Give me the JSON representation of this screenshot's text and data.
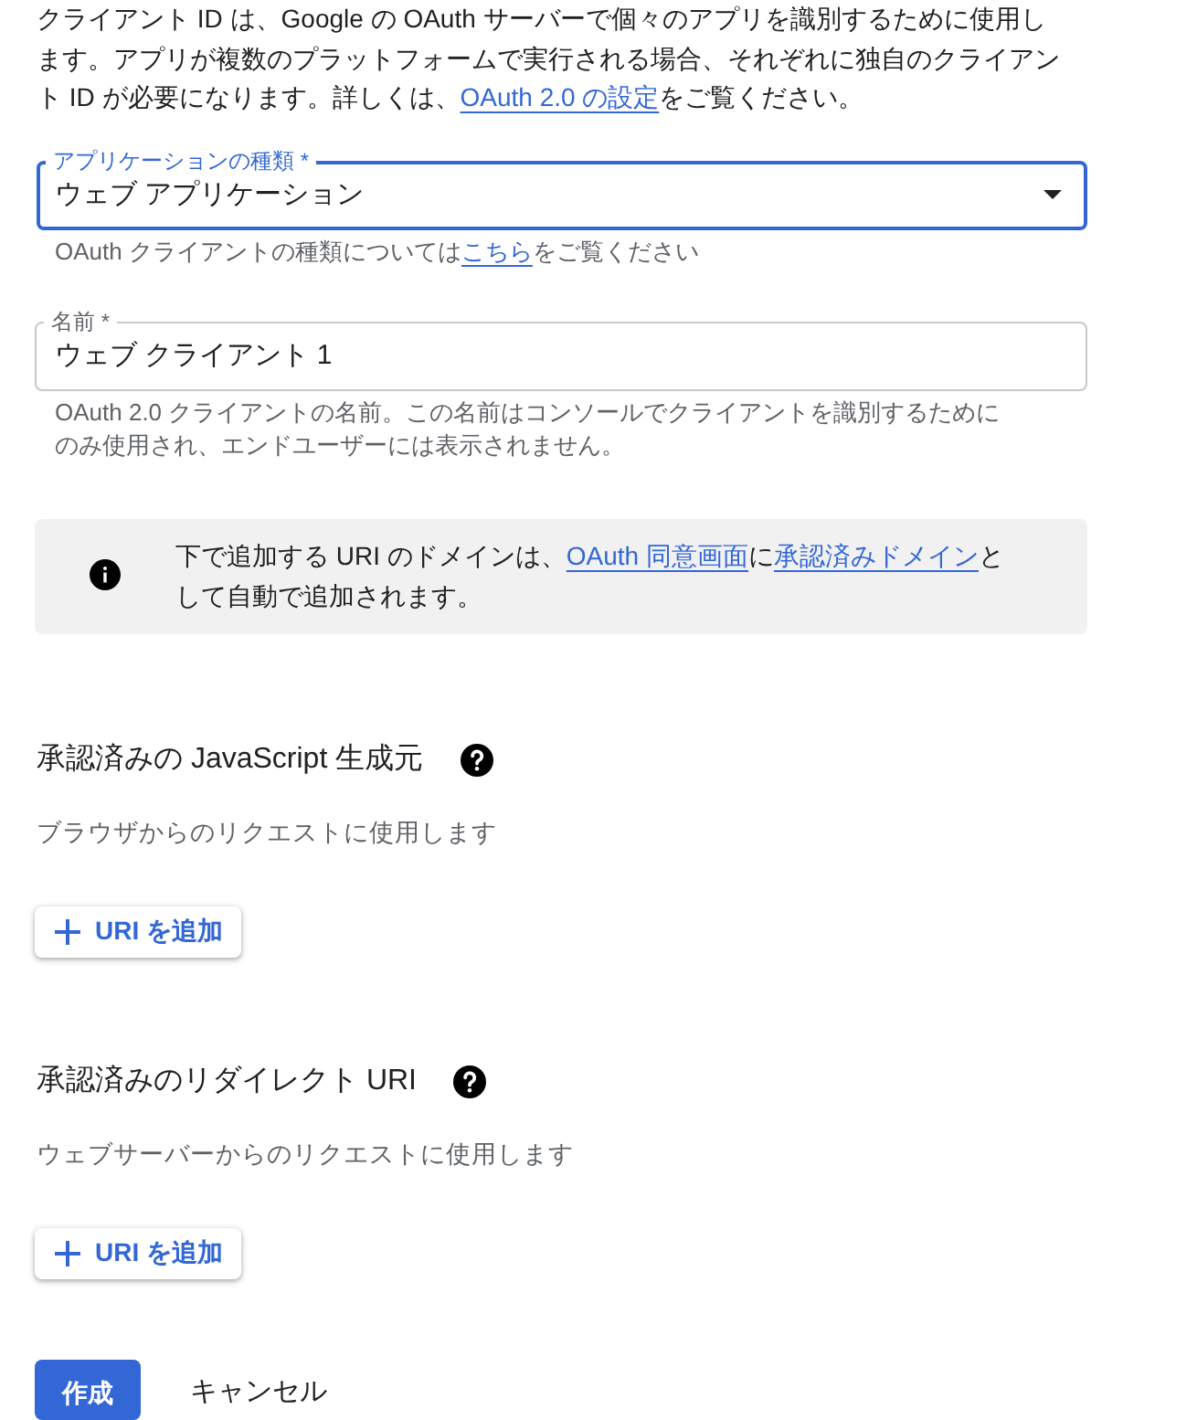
{
  "intro": [
    {
      "kind": "text",
      "text": "クライアント ID は、Google の OAuth サーバーで個々のアプリを識別するために使用します。アプリが複数のプラットフォームで実行される場合、それぞれに独自のクライアント ID が必要になります。詳しくは、"
    },
    {
      "kind": "link",
      "text": "OAuth 2.0 の設定"
    },
    {
      "kind": "text",
      "text": "をご覧ください。"
    }
  ],
  "fields": [
    {
      "kind": "select",
      "label": "アプリケーションの種類 *",
      "value": "ウェブ アプリケーション",
      "focused": true,
      "helper": [
        {
          "kind": "text",
          "text": "OAuth クライアントの種類については"
        },
        {
          "kind": "link",
          "text": "こちら"
        },
        {
          "kind": "text",
          "text": "をご覧ください"
        }
      ]
    },
    {
      "kind": "text",
      "label": "名前 *",
      "value": "ウェブ クライアント 1",
      "focused": false,
      "helper": [
        {
          "kind": "text",
          "text": "OAuth 2.0 クライアントの名前。この名前はコンソールでクライアントを識別するためにのみ使用され、エンドユーザーには表示されません。"
        }
      ]
    }
  ],
  "notice": [
    {
      "kind": "text",
      "text": "下で追加する URI のドメインは、"
    },
    {
      "kind": "link",
      "text": "OAuth 同意画面"
    },
    {
      "kind": "text",
      "text": "に"
    },
    {
      "kind": "link",
      "text": "承認済みドメイン"
    },
    {
      "kind": "text",
      "text": "として自動で追加されます。"
    }
  ],
  "sections": [
    {
      "title": "承認済みの JavaScript 生成元",
      "description": "ブラウザからのリクエストに使用します",
      "button": "URI を追加"
    },
    {
      "title": "承認済みのリダイレクト URI",
      "description": "ウェブサーバーからのリクエストに使用します",
      "button": "URI を追加"
    }
  ],
  "actions": [
    {
      "kind": "primary",
      "label": "作成"
    },
    {
      "kind": "text",
      "label": "キャンセル"
    }
  ]
}
